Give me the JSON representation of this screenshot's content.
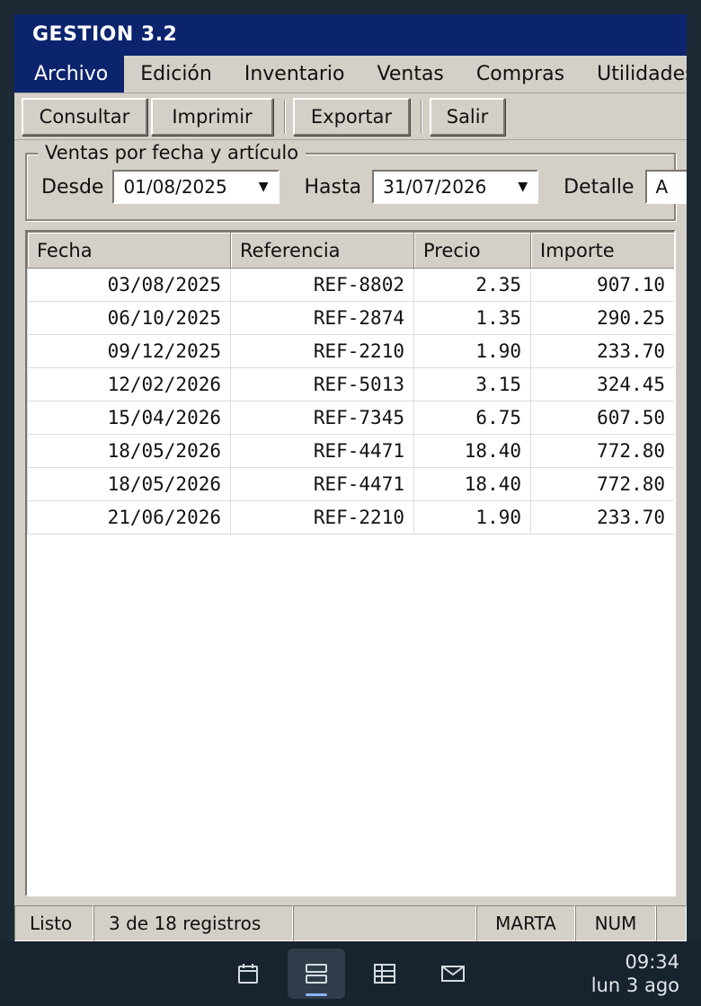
{
  "window": {
    "title": "GESTION 3.2"
  },
  "menu": [
    "Archivo",
    "Edición",
    "Inventario",
    "Ventas",
    "Compras",
    "Utilidades"
  ],
  "toolbar": {
    "consultar": "Consultar",
    "imprimir": "Imprimir",
    "exportar": "Exportar",
    "salir": "Salir"
  },
  "filter": {
    "legend": "Ventas por fecha y artículo",
    "desde_label": "Desde",
    "desde_value": "01/08/2025",
    "hasta_label": "Hasta",
    "hasta_value": "31/07/2026",
    "detalle_label": "Detalle",
    "detalle_value": "A"
  },
  "table": {
    "headers": [
      "Fecha",
      "Referencia",
      "Precio",
      "Importe"
    ],
    "rows": [
      [
        "03/08/2025",
        "REF-8802",
        "2.35",
        "907.10"
      ],
      [
        "06/10/2025",
        "REF-2874",
        "1.35",
        "290.25"
      ],
      [
        "09/12/2025",
        "REF-2210",
        "1.90",
        "233.70"
      ],
      [
        "12/02/2026",
        "REF-5013",
        "3.15",
        "324.45"
      ],
      [
        "15/04/2026",
        "REF-7345",
        "6.75",
        "607.50"
      ],
      [
        "18/05/2026",
        "REF-4471",
        "18.40",
        "772.80"
      ],
      [
        "18/05/2026",
        "REF-4471",
        "18.40",
        "772.80"
      ],
      [
        "21/06/2026",
        "REF-2210",
        "1.90",
        "233.70"
      ]
    ]
  },
  "status": {
    "state": "Listo",
    "records": "3 de 18 registros",
    "user": "MARTA",
    "num": "NUM"
  },
  "taskbar": {
    "icons": [
      "calendar-icon",
      "list-view-icon",
      "table-icon",
      "mail-icon"
    ],
    "time": "09:34",
    "date": "lun 3 ago"
  }
}
